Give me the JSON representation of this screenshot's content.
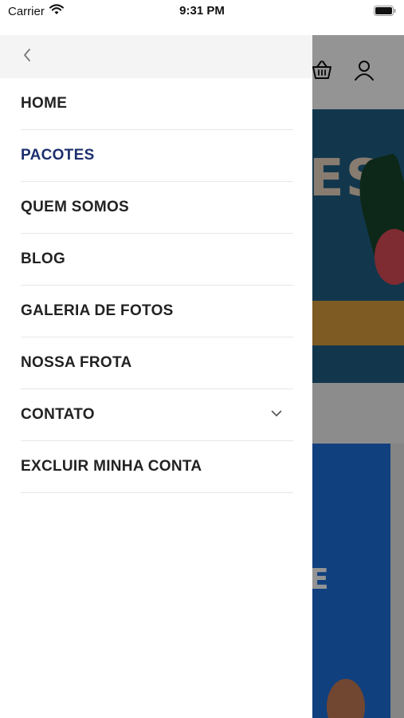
{
  "status_bar": {
    "carrier": "Carrier",
    "time": "9:31 PM"
  },
  "background": {
    "banner_text": "ES",
    "card_text": "E"
  },
  "menu": {
    "items": [
      {
        "label": "HOME",
        "active": false
      },
      {
        "label": "PACOTES",
        "active": true
      },
      {
        "label": "QUEM SOMOS",
        "active": false
      },
      {
        "label": "BLOG",
        "active": false
      },
      {
        "label": "GALERIA DE FOTOS",
        "active": false
      },
      {
        "label": "NOSSA FROTA",
        "active": false
      },
      {
        "label": "CONTATO",
        "active": false,
        "has_submenu": true
      },
      {
        "label": "EXCLUIR MINHA CONTA",
        "active": false
      }
    ]
  },
  "colors": {
    "active": "#1c2f6e",
    "text": "#222222",
    "overlay": "rgba(0,0,0,0.42)"
  },
  "icons": {
    "back": "chevron-left-icon",
    "expand": "chevron-down-icon",
    "cart": "basket-icon",
    "user": "user-icon",
    "wifi": "wifi-icon",
    "battery": "battery-icon"
  }
}
